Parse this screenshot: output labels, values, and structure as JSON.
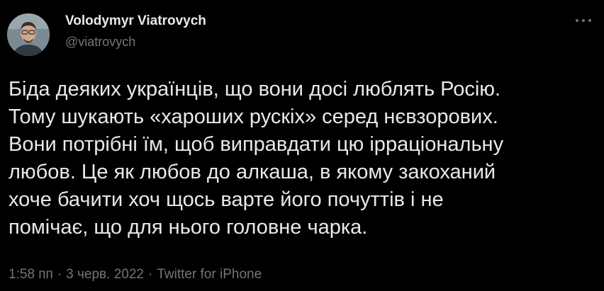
{
  "author": {
    "display_name": "Volodymyr Viatrovych",
    "handle": "@viatrovych"
  },
  "tweet": {
    "lines": [
      "Біда деяких українців, що вони досі люблять Росію.",
      "Тому шукають «хароших рускіх» серед нєвзорових.",
      "Вони потрібні їм, щоб виправдати цю ірраціональну",
      "любов. Це як любов до алкаша, в якому закоханий",
      "хоче бачити хоч щось варте його почуттів і не",
      "помічає, що для нього головне чарка."
    ]
  },
  "meta": {
    "time": "1:58 пп",
    "separator": "·",
    "date": "3 черв. 2022",
    "source": "Twitter for iPhone"
  },
  "icons": {
    "more": "more-horizontal-icon",
    "avatar": "profile-photo"
  },
  "colors": {
    "background": "#000000",
    "primary_text": "#e7e9ea",
    "secondary_text": "#71767b"
  }
}
